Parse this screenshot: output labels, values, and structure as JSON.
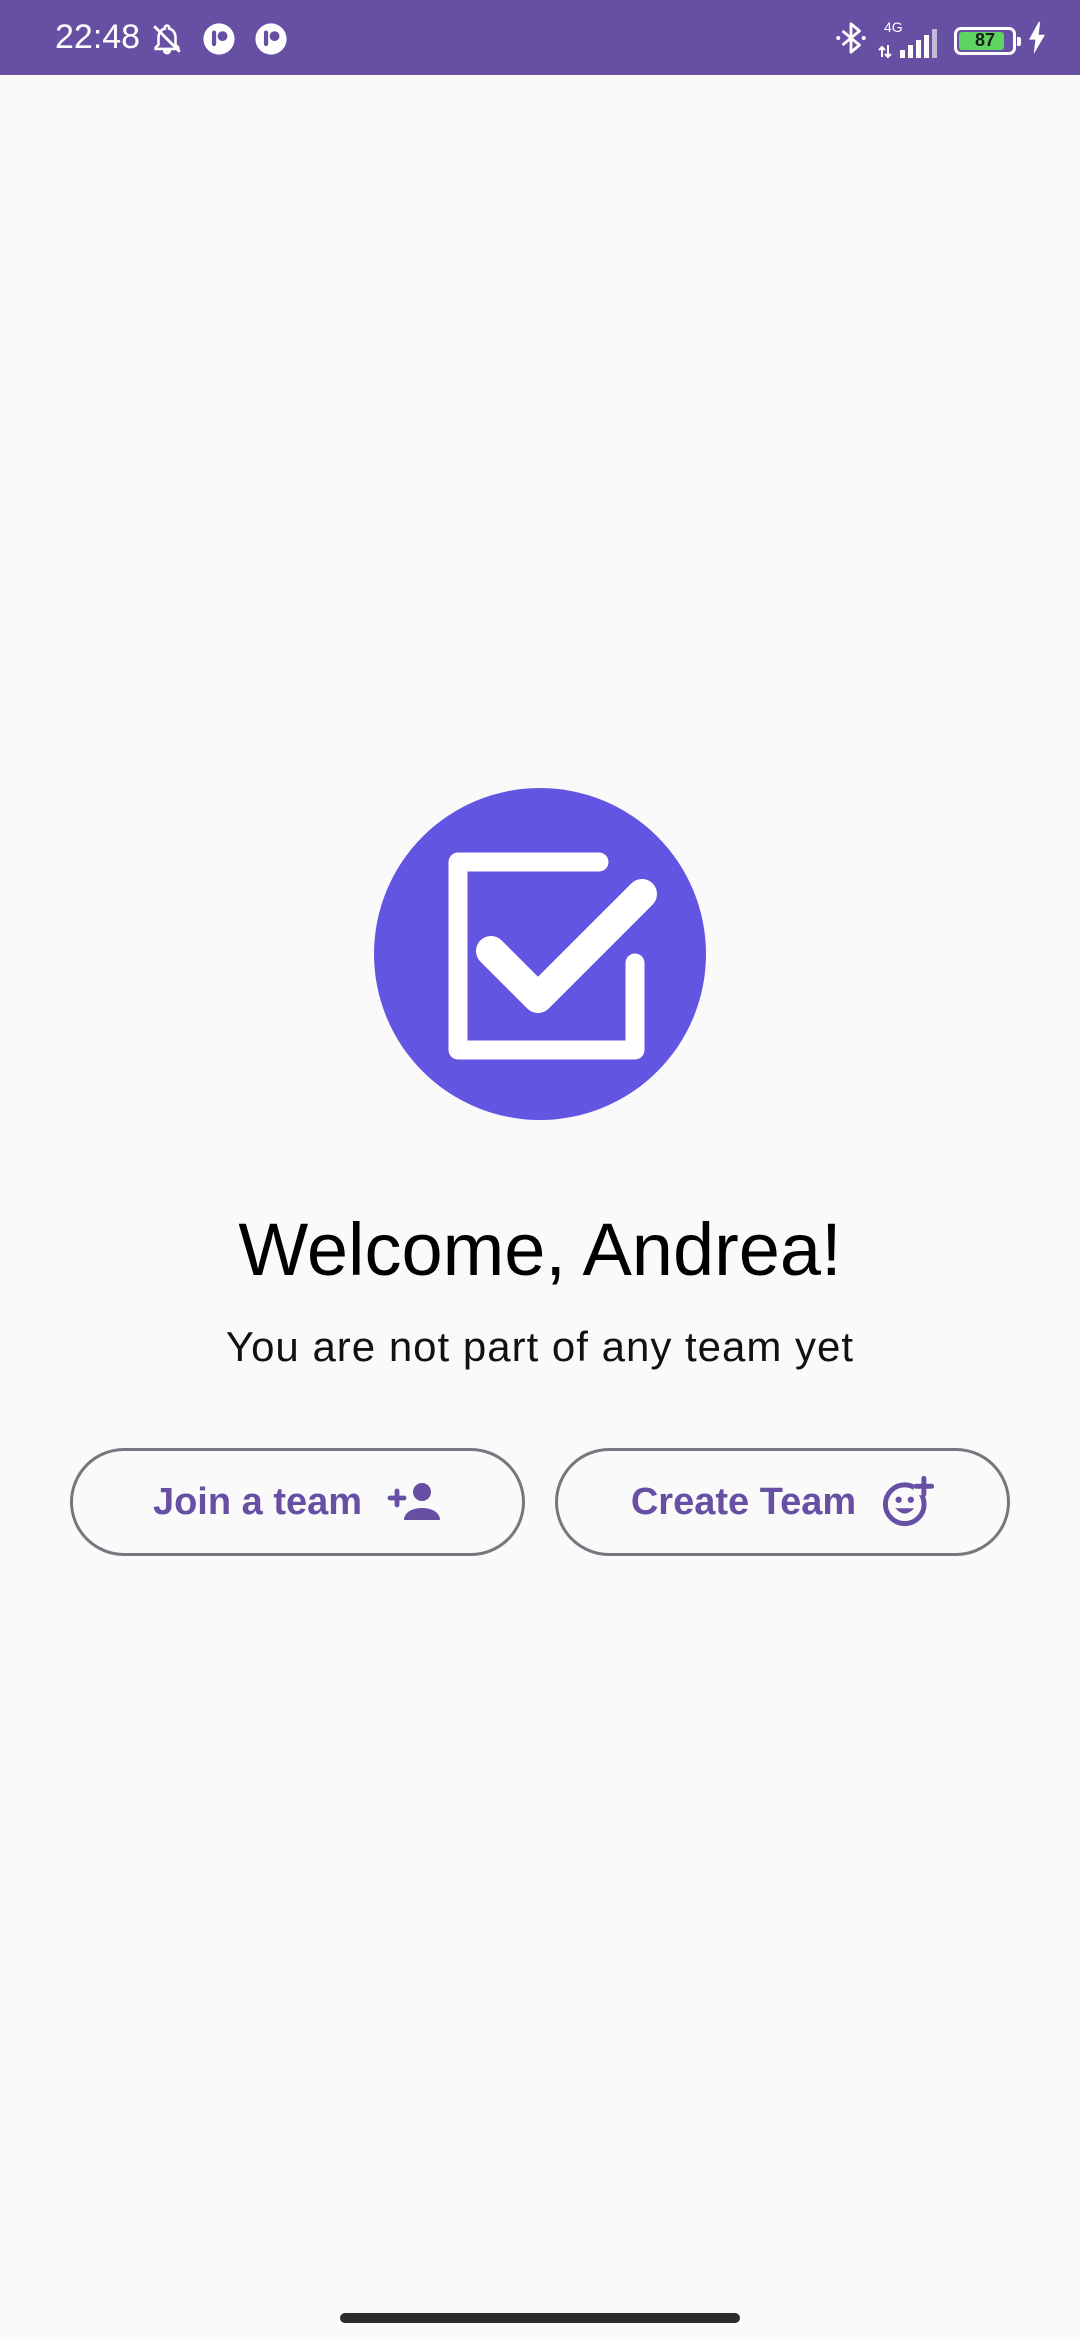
{
  "status_bar": {
    "time": "22:48",
    "network_type": "4G",
    "battery_level": "87",
    "background_color": "#6750a4",
    "battery_color": "#5fd35f",
    "left_icons": [
      "bell-off-icon",
      "app-notification-icon",
      "app-notification-icon"
    ],
    "right_icons": [
      "bluetooth-icon",
      "signal-icon",
      "battery-icon",
      "charging-icon"
    ]
  },
  "logo": {
    "icon": "checkbox-checked-icon",
    "background_color": "#6255e2"
  },
  "welcome": {
    "title": "Welcome, Andrea!",
    "subtitle": "You are not part of any team yet"
  },
  "actions": {
    "join_label": "Join a team",
    "join_icon": "person-add-icon",
    "create_label": "Create Team",
    "create_icon": "add-reaction-icon",
    "accent_color": "#6750a4"
  }
}
